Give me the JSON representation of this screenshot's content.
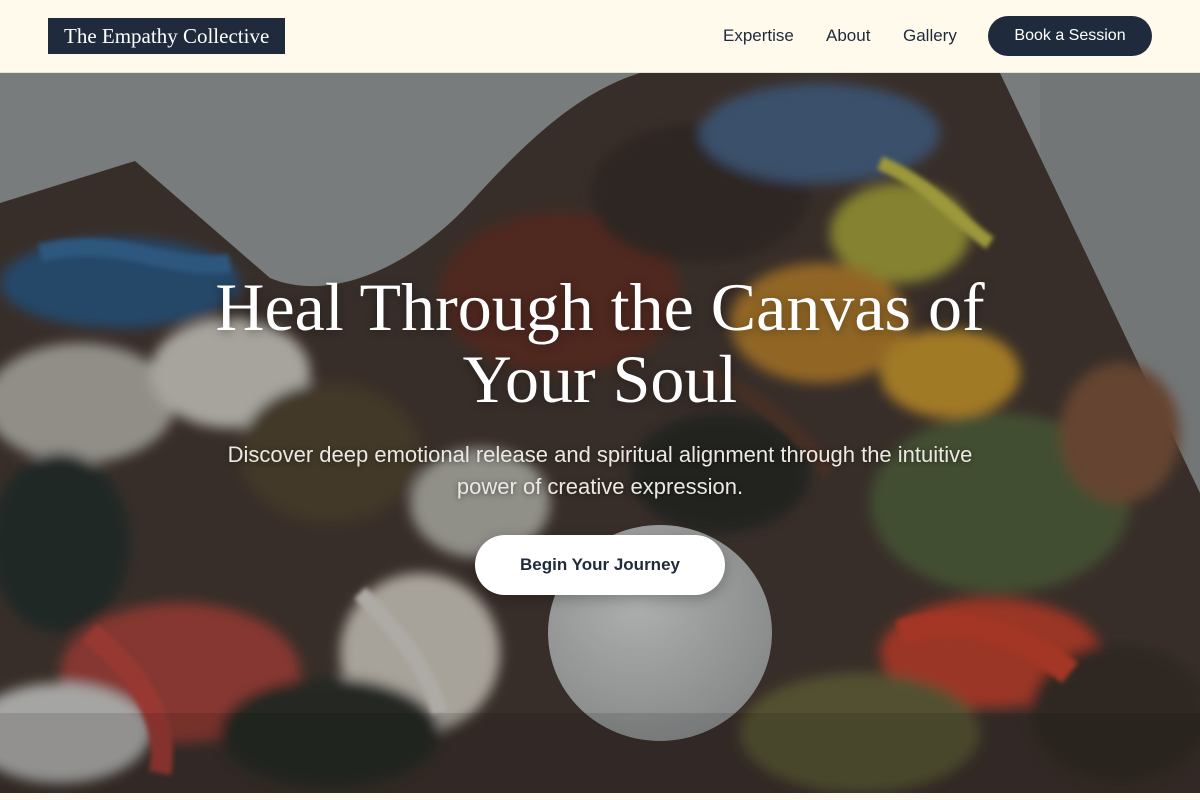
{
  "header": {
    "logo_text": "The Empathy Collective",
    "nav": {
      "expertise": "Expertise",
      "about": "About",
      "gallery": "Gallery"
    },
    "cta_label": "Book a Session"
  },
  "hero": {
    "title": "Heal Through the Canvas of Your Soul",
    "subtitle": "Discover deep emotional release and spiritual alignment through the intuitive power of creative expression.",
    "cta_label": "Begin Your Journey"
  },
  "colors": {
    "brand_navy": "#1f2a3d",
    "header_background": "#fffaec",
    "cta_light": "#ffffff"
  }
}
